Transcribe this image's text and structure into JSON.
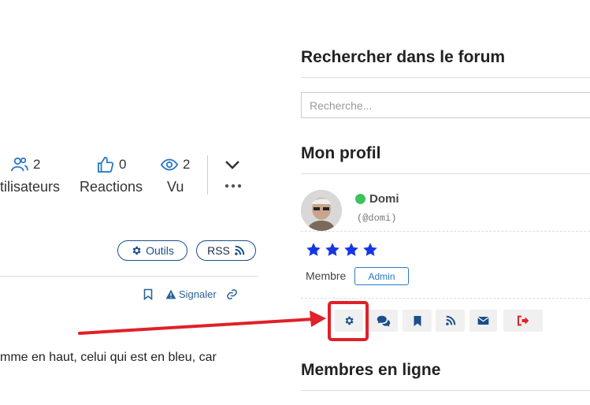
{
  "stats": {
    "users": {
      "count": "2",
      "label": "tilisateurs"
    },
    "reactions": {
      "count": "0",
      "label": "Reactions"
    },
    "views": {
      "count": "2",
      "label": "Vu"
    }
  },
  "toolbar": {
    "tools_label": "Outils",
    "rss_label": "RSS"
  },
  "post_actions": {
    "report_label": "Signaler"
  },
  "post": {
    "text": "mme en haut, celui qui est en bleu, car"
  },
  "sidebar": {
    "search_title": "Rechercher dans le forum",
    "search_placeholder": "Recherche...",
    "profile_title": "Mon profil",
    "profile": {
      "name": "Domi",
      "handle": "(@domi)",
      "rating_stars": 4,
      "role_label": "Membre",
      "role_badge": "Admin"
    },
    "online_title": "Membres en ligne"
  },
  "colors": {
    "accent": "#2b78c5",
    "annotation": "#e0202a",
    "online": "#3cc35a",
    "star": "#1636e6"
  }
}
